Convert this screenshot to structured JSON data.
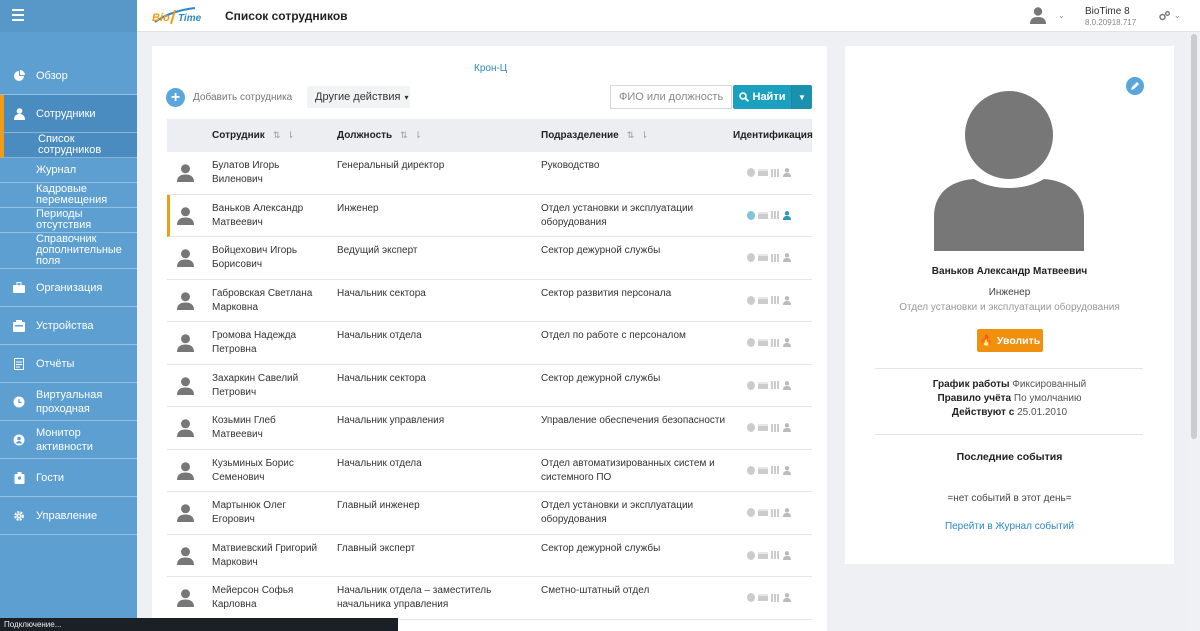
{
  "app": {
    "title": "Список сотрудников",
    "product_name": "BioTime 8",
    "product_version": "8.0.20918.717",
    "logo_text": "BioTime"
  },
  "sidebar": {
    "items": [
      {
        "label": "Обзор",
        "icon": "dashboard-icon"
      },
      {
        "label": "Сотрудники",
        "icon": "user-icon"
      },
      {
        "label": "Организация",
        "icon": "briefcase-icon"
      },
      {
        "label": "Устройства",
        "icon": "devices-icon"
      },
      {
        "label": "Отчёты",
        "icon": "report-icon"
      },
      {
        "label": "Виртуальная проходная",
        "icon": "clock-icon"
      },
      {
        "label": "Монитор активности",
        "icon": "monitor-icon"
      },
      {
        "label": "Гости",
        "icon": "guest-icon"
      },
      {
        "label": "Управление",
        "icon": "gear-icon"
      }
    ],
    "subitems": [
      {
        "label": "Список сотрудников"
      },
      {
        "label": "Журнал"
      },
      {
        "label": "Кадровые перемещения"
      },
      {
        "label": "Периоды отсутствия"
      },
      {
        "label": "Справочник дополнительные поля"
      }
    ]
  },
  "toolbar": {
    "org_link": "Крон-Ц",
    "add_label": "Добавить сотрудника",
    "more_label": "Другие действия",
    "search_placeholder": "ФИО или должность",
    "find_label": "Найти"
  },
  "table": {
    "headers": {
      "name": "Сотрудник",
      "position": "Должность",
      "department": "Подразделение",
      "ident": "Идентификация"
    },
    "rows": [
      {
        "name": "Булатов Игорь Виленович",
        "position": "Генеральный директор",
        "department": "Руководство"
      },
      {
        "name": "Ваньков Александр Матвеевич",
        "position": "Инженер",
        "department": "Отдел установки и эксплуатации оборудования"
      },
      {
        "name": "Войцехович Игорь Борисович",
        "position": "Ведущий эксперт",
        "department": "Сектор дежурной службы"
      },
      {
        "name": "Габровская Светлана Марковна",
        "position": "Начальник сектора",
        "department": "Сектор развития персонала"
      },
      {
        "name": "Громова Надежда Петровна",
        "position": "Начальник отдела",
        "department": "Отдел по работе с персоналом"
      },
      {
        "name": "Захаркин Савелий Петрович",
        "position": "Начальник сектора",
        "department": "Сектор дежурной службы"
      },
      {
        "name": "Козьмин Глеб Матвеевич",
        "position": "Начальник управления",
        "department": "Управление обеспечения безопасности"
      },
      {
        "name": "Кузьминых Борис Семенович",
        "position": "Начальник отдела",
        "department": "Отдел автоматизированных систем и системного ПО"
      },
      {
        "name": "Мартынюк Олег Егорович",
        "position": "Главный инженер",
        "department": "Отдел установки и эксплуатации оборудования"
      },
      {
        "name": "Матвиевский Григорий Маркович",
        "position": "Главный эксперт",
        "department": "Сектор дежурной службы"
      },
      {
        "name": "Мейерсон Софья Карловна",
        "position": "Начальник отдела – заместитель начальника управления",
        "department": "Сметно-штатный отдел"
      }
    ]
  },
  "profile": {
    "name": "Ваньков Александр Матвеевич",
    "position": "Инженер",
    "department": "Отдел установки и эксплуатации оборудования",
    "fire_label": "Уволить",
    "schedule_label": "График работы",
    "schedule_value": "Фиксированный",
    "rule_label": "Правило учёта",
    "rule_value": "По умолчанию",
    "valid_label": "Действуют с",
    "valid_value": "25.01.2010",
    "events_title": "Последние события",
    "no_events": "=нет событий в этот день=",
    "journal_link": "Перейти в Журнал событий"
  },
  "status_bar": {
    "text": "Подключение..."
  },
  "colors": {
    "sidebar": "#5c9fd0",
    "accent": "#f39c12",
    "primary_button": "#1ba0bf",
    "fire_button": "#f0900e"
  }
}
